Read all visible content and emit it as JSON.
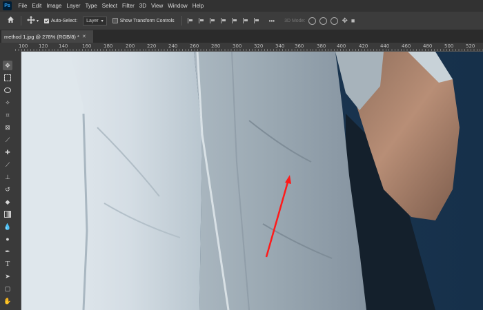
{
  "app": {
    "logo_text": "Ps"
  },
  "menu": [
    "File",
    "Edit",
    "Image",
    "Layer",
    "Type",
    "Select",
    "Filter",
    "3D",
    "View",
    "Window",
    "Help"
  ],
  "options": {
    "auto_select_label": "Auto-Select:",
    "layer_dropdown": "Layer",
    "show_transform_label": "Show Transform Controls",
    "more": "•••",
    "mode_3d_label": "3D Mode:"
  },
  "tab": {
    "title": "method 1.jpg @ 278% (RGB/8) *",
    "close": "✕"
  },
  "ruler": {
    "ticks": [
      "100",
      "120",
      "140",
      "160",
      "180",
      "200",
      "220",
      "240",
      "260",
      "280",
      "300",
      "320",
      "340",
      "360",
      "380",
      "400",
      "420",
      "440",
      "460",
      "480",
      "500",
      "520"
    ]
  },
  "colors": {
    "annotation_arrow": "#ff1a1a",
    "background_wall": "#1c3550",
    "shirt": "#c3cfd7"
  }
}
